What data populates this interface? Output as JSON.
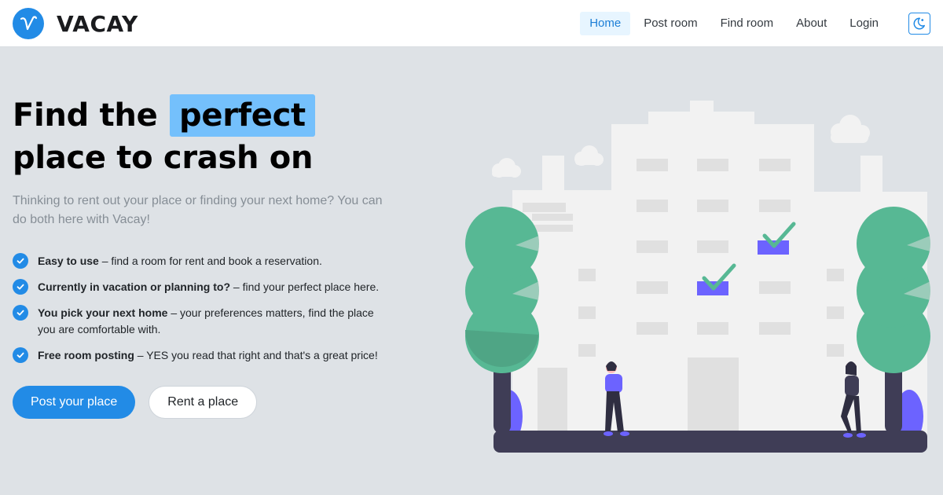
{
  "brand": {
    "name": "VACAY",
    "logo_icon": "v-logo-icon"
  },
  "nav": {
    "links": [
      {
        "label": "Home",
        "active": true
      },
      {
        "label": "Post room",
        "active": false
      },
      {
        "label": "Find room",
        "active": false
      },
      {
        "label": "About",
        "active": false
      },
      {
        "label": "Login",
        "active": false
      }
    ],
    "theme_toggle_icon": "moon-icon"
  },
  "hero": {
    "title_part1": "Find the",
    "title_highlight": "perfect",
    "title_part2": "place to crash on",
    "subtitle": "Thinking to rent out your place or finding your next home? You can do both here with Vacay!",
    "features": [
      {
        "title": "Easy to use",
        "text": " – find a room for rent and book a reservation."
      },
      {
        "title": "Currently in vacation or planning to?",
        "text": " – find your perfect place here."
      },
      {
        "title": "You pick your next home",
        "text": " – your preferences matters, find the place you are comfortable with."
      },
      {
        "title": "Free room posting",
        "text": " – YES you read that right and that's a great price!"
      }
    ],
    "primary_button": "Post your place",
    "secondary_button": "Rent a place"
  },
  "colors": {
    "accent": "#228be6",
    "highlight": "#74c0fc",
    "background": "#dee2e6",
    "tree_green": "#57b894",
    "purple": "#6c63ff"
  }
}
